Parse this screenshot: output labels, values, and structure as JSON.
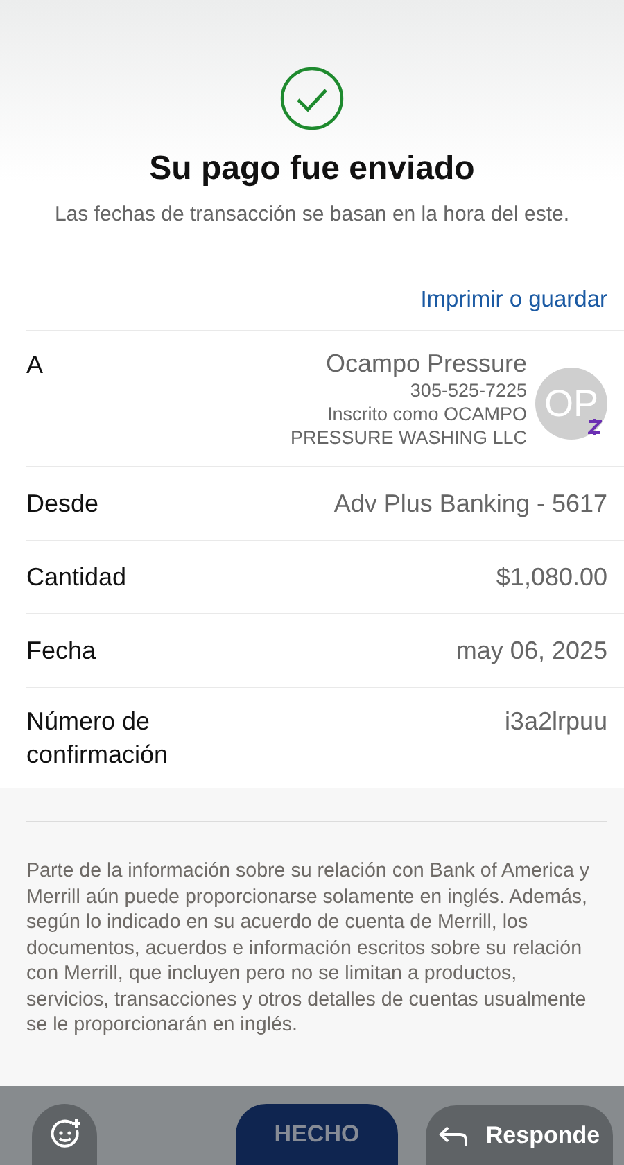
{
  "header": {
    "title": "Su pago fue enviado",
    "subtitle": "Las fechas de transacción se basan en la hora del este.",
    "link": "Imprimir o guardar"
  },
  "recipient": {
    "label": "A",
    "name": "Ocampo Pressure",
    "phone": "305-525-7225",
    "enrolled": "Inscrito como OCAMPO PRESSURE WASHING LLC",
    "initials": "OP"
  },
  "details": [
    {
      "label": "Desde",
      "value": "Adv Plus Banking - 5617"
    },
    {
      "label": "Cantidad",
      "value": "$1,080.00"
    },
    {
      "label": "Fecha",
      "value": "may 06, 2025"
    },
    {
      "label": "Número de confirmación",
      "value": "i3a2lrpuu"
    }
  ],
  "disclaimer": "Parte de la información sobre su relación con Bank of America y Merrill aún puede proporcionarse solamente en inglés. Además, según lo indicado en su acuerdo de cuenta de Merrill, los documentos, acuerdos e información escritos sobre su relación con Merrill, que incluyen pero no se limitan a productos, servicios, transacciones y otros detalles de cuentas usualmente se le proporcionarán en inglés.",
  "bottom_bar": {
    "done": "HECHO",
    "reply": "Responde"
  }
}
